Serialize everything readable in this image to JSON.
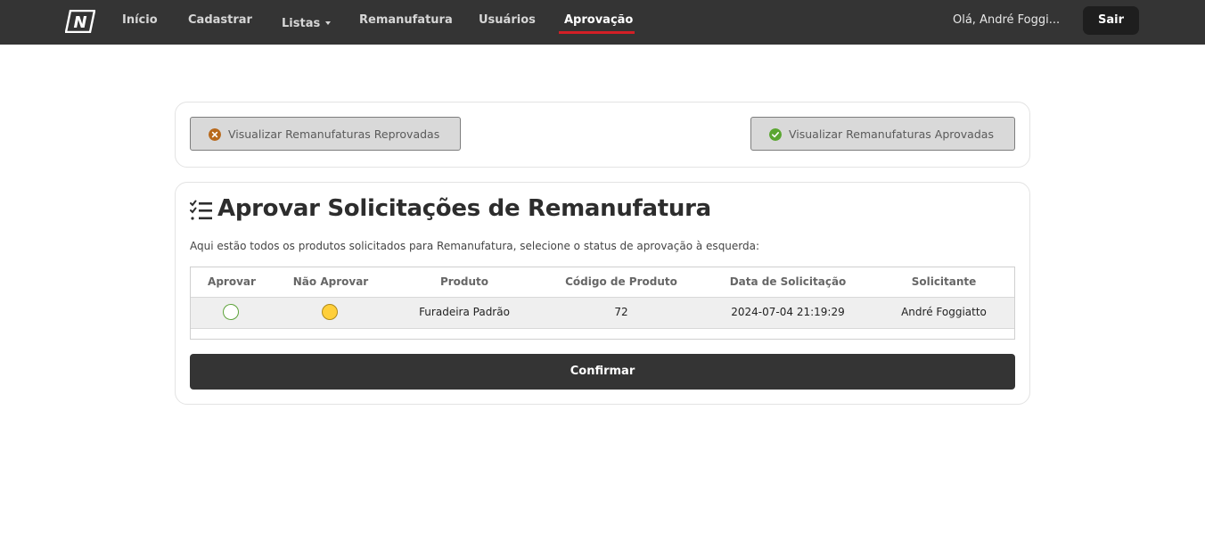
{
  "nav": {
    "logo_letter": "N",
    "links": [
      "Início",
      "Cadastrar",
      "Listas",
      "Remanufatura",
      "Usuários",
      "Aprovação"
    ],
    "active": "Aprovação",
    "greeting": "Olá, André Foggi...",
    "logout_label": "Sair",
    "accent_color": "#d31f26"
  },
  "filters": {
    "rejected_label": "Visualizar Remanufaturas Reprovadas",
    "rejected_icon": "x-circle-icon",
    "approved_label": "Visualizar Remanufaturas Aprovadas",
    "approved_icon": "check-circle-icon"
  },
  "main": {
    "title": "Aprovar Solicitações de Remanufatura",
    "title_icon": "checklist-icon",
    "description": "Aqui estão todos os produtos solicitados para Remanufatura, selecione o status de aprovação à esquerda:",
    "columns": [
      "Aprovar",
      "Não Aprovar",
      "Produto",
      "Código de Produto",
      "Data de Solicitação",
      "Solicitante"
    ],
    "rows": [
      {
        "product": "Furadeira Padrão",
        "code": "72",
        "date": "2024-07-04 21:19:29",
        "requester": "André Foggiatto",
        "selected": "Não Aprovar"
      }
    ],
    "confirm_label": "Confirmar"
  }
}
